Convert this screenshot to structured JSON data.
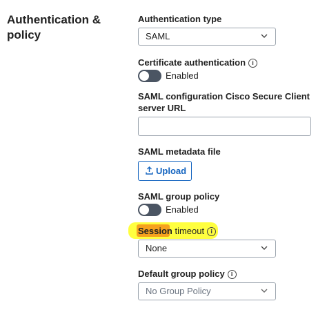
{
  "section": {
    "title": "Authentication & policy"
  },
  "auth_type": {
    "label": "Authentication type",
    "value": "SAML"
  },
  "cert_auth": {
    "label": "Certificate authentication",
    "toggle_label": "Enabled",
    "enabled": false
  },
  "saml_url": {
    "label": "SAML configuration Cisco Secure Client server URL",
    "value": ""
  },
  "saml_metadata": {
    "label": "SAML metadata file",
    "upload_label": "Upload"
  },
  "saml_group_policy": {
    "label": "SAML group policy",
    "toggle_label": "Enabled",
    "enabled": false
  },
  "session_timeout": {
    "label_part1": "Session",
    "label_part2": " timeout",
    "value": "None"
  },
  "default_group_policy": {
    "label": "Default group policy",
    "value": "No Group Policy"
  },
  "colors": {
    "highlight": "#ffff3f",
    "highlight_strong": "#f6a21e",
    "accent": "#1565c0",
    "toggle_off": "#4b5563"
  },
  "icons": {
    "info": "info-circle-icon",
    "chevron": "chevron-down-icon",
    "upload": "upload-icon"
  }
}
